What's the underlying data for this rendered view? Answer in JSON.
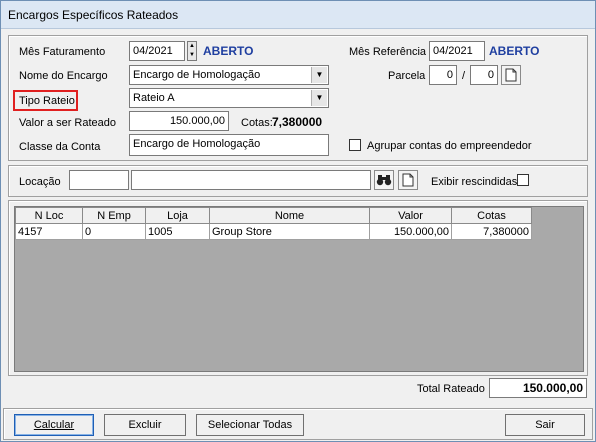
{
  "window": {
    "title": "Encargos Específicos Rateados"
  },
  "form": {
    "mes_faturamento_label": "Mês Faturamento",
    "mes_faturamento_value": "04/2021",
    "mes_faturamento_status": "ABERTO",
    "mes_referencia_label": "Mês Referência",
    "mes_referencia_value": "04/2021",
    "mes_referencia_status": "ABERTO",
    "nome_encargo_label": "Nome do Encargo",
    "nome_encargo_value": "Encargo de Homologação",
    "parcela_label": "Parcela",
    "parcela_num": "0",
    "parcela_sep": "/",
    "parcela_total": "0",
    "tipo_rateio_label": "Tipo Rateio",
    "tipo_rateio_value": "Rateio A",
    "valor_label": "Valor a ser Rateado",
    "valor_value": "150.000,00",
    "cotas_label": "Cotas:",
    "cotas_value": "7,380000",
    "classe_label": "Classe da Conta",
    "classe_value": "Encargo de Homologação",
    "agrupar_label": "Agrupar contas do empreendedor",
    "agrupar_checked": false
  },
  "filter": {
    "locacao_label": "Locação",
    "locacao_code": "",
    "locacao_name": "",
    "exibir_label": "Exibir rescindidas",
    "exibir_checked": false,
    "search_icon": "binoculars-icon",
    "new_icon": "new-document-icon"
  },
  "grid": {
    "columns": [
      "N Loc",
      "N Emp",
      "Loja",
      "Nome",
      "Valor",
      "Cotas"
    ],
    "rows": [
      [
        "4157",
        "0",
        "1005",
        "Group Store",
        "150.000,00",
        "7,380000"
      ]
    ]
  },
  "totals": {
    "label": "Total Rateado",
    "value": "150.000,00"
  },
  "buttons": {
    "calcular": "Calcular",
    "excluir": "Excluir",
    "selecionar_todas": "Selecionar Todas",
    "sair": "Sair"
  }
}
